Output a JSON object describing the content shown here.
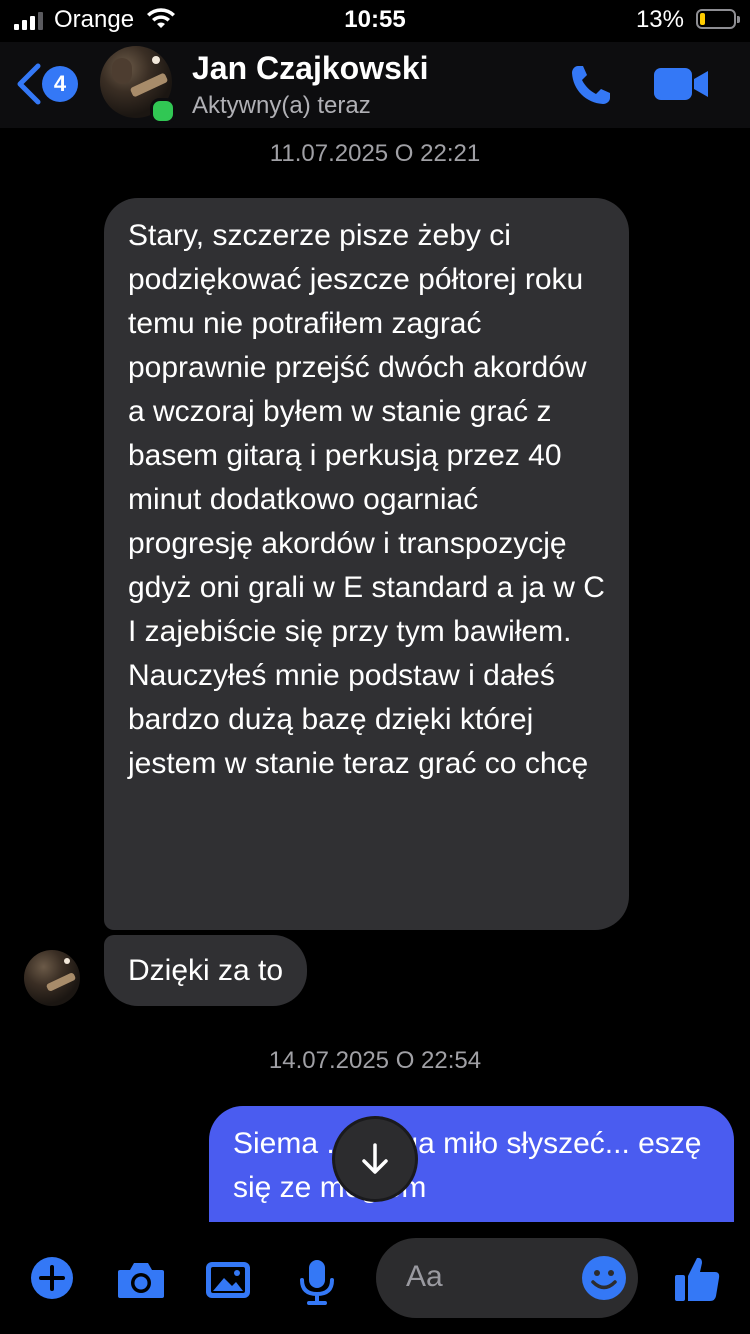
{
  "status_bar": {
    "carrier": "Orange",
    "time": "10:55",
    "battery": "13%",
    "battery_level": 0.13
  },
  "header": {
    "back_badge": "4",
    "contact_name": "Jan Czajkowski",
    "contact_status": "Aktywny(a) teraz",
    "icons": [
      "chevron-left-icon",
      "phone-icon",
      "video-camera-icon"
    ]
  },
  "conversation": {
    "timestamp_1": "11.07.2025 O 22:21",
    "incoming_message_1": "Stary, szczerze pisze żeby ci podziękować jeszcze półtorej roku temu nie potrafiłem zagrać poprawnie przejść dwóch akordów a wczoraj byłem w stanie grać z basem gitarą i perkusją przez 40 minut dodatkowo ogarniać progresję akordów i transpozycję gdyż oni grali w E standard a ja w C I zajebiście się przy tym bawiłem. Nauczyłeś mnie podstaw i dałeś bardzo dużą bazę dzięki której jestem w stanie teraz grać co chcę",
    "incoming_message_2": "Dzięki za to",
    "timestamp_2": "14.07.2025 O 22:54",
    "outgoing_message_1": "Siema ... mega miło słyszeć... eszę się ze mogłem"
  },
  "composer": {
    "placeholder": "Aa",
    "icons": [
      "plus-icon",
      "camera-icon",
      "image-icon",
      "microphone-icon",
      "emoji-icon",
      "thumbs-up-icon"
    ]
  },
  "colors": {
    "accent": "#3478f6",
    "outgoing_bubble": "#4a5cf0",
    "incoming_bubble": "#303033",
    "online": "#31c754"
  }
}
